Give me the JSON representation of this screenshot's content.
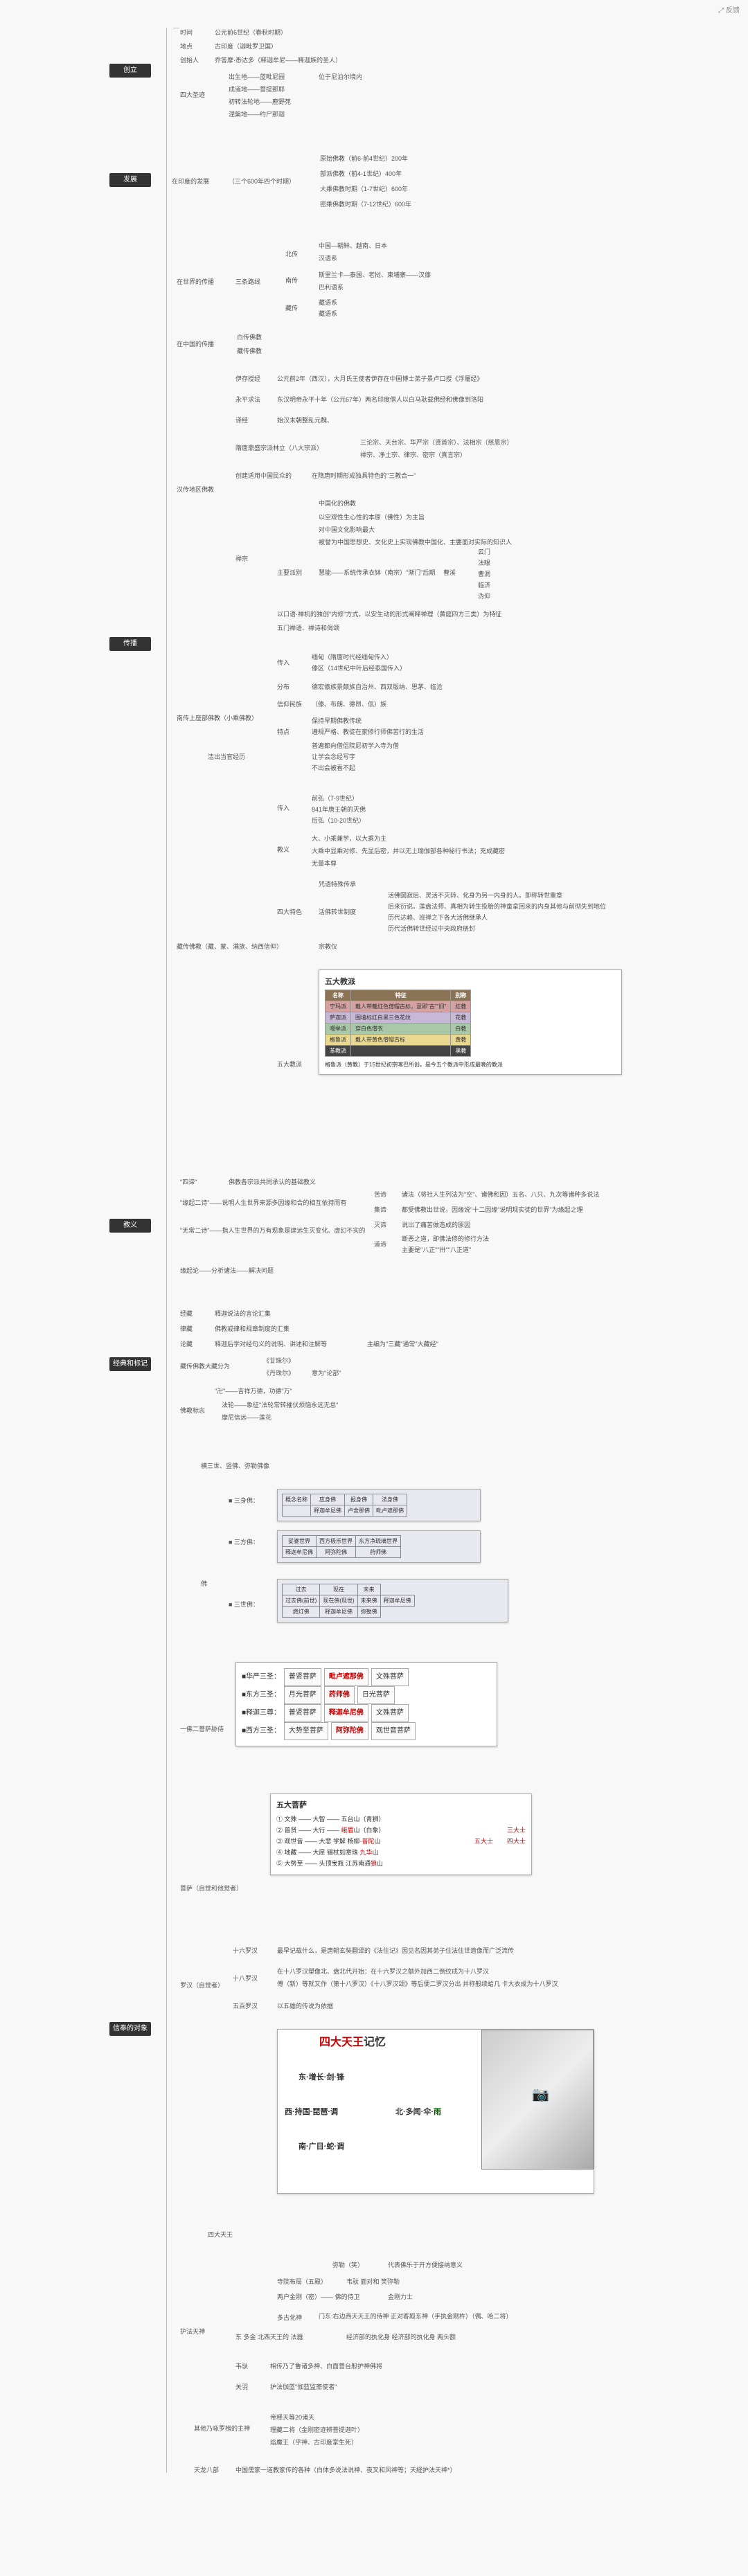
{
  "topright": "反馈",
  "roots": {
    "r1": "创立",
    "r2": "发展",
    "r3": "传播",
    "r4": "教义",
    "r5": "经典和标记",
    "r6": "信奉的对象"
  },
  "s1": {
    "time": "时间",
    "time_v": "公元前6世纪（春秋时期）",
    "place": "地点",
    "place_v": "古印度（迦毗罗卫国）",
    "founder": "创始人",
    "founder_v": "乔答摩·悉达多（释迦牟尼——释迦族的圣人）",
    "four": "四大圣迹",
    "f1": "出生地——蓝毗尼园",
    "f1_v": "位于尼泊尔境内",
    "f2": "成道地——菩提那耶",
    "f3": "初转法轮地——鹿野苑",
    "f4": "涅槃地——约尸那迦"
  },
  "s2": {
    "title": "在印度的发展",
    "sub": "（三个600年四个时期）",
    "p1": "原始佛教（前6-前4世纪）200年",
    "p2": "部派佛教（前4-1世纪）400年",
    "p3": "大乘佛教时期（1-7世纪）600年",
    "p4": "密乘佛教时期（7-12世纪）600年"
  },
  "s3": {
    "world": "在世界的传播",
    "three": "三条路线",
    "north": "北传",
    "north_v": "中国—朝鲜、越南、日本",
    "north_s": "汉语系",
    "south": "南传",
    "south_v": "斯里兰卡—泰国、老挝、柬埔寨——汉傣",
    "south_s": "巴利语系",
    "west": "藏传",
    "west_s": "藏语系",
    "cn": "在中国的传播",
    "cn1": "白传佛教",
    "cn2": "藏传佛教",
    "han": "汉传地区佛教",
    "han1": "伊存授经",
    "han1_v": "公元前2年（西汉），大月氏王使者伊存在中国博士弟子景卢口授《浮屠经》",
    "han2": "永平求法",
    "han2_v": "东汉明帝永平十年（公元67年）两名印度僧人以白马驮载佛经和佛像到洛阳",
    "han3": "译经",
    "han3_v": "始汉末朝整乱元魏、",
    "han3_a": "三论宗、天台宗、华严宗（贤首宗）、法相宗（慈恩宗）",
    "han3_b": "禅宗、净土宗、律宗、密宗（真言宗）",
    "han4": "隋唐鼎盛宗派林立（八大宗派）",
    "han5": "创建适用中国民众的",
    "han5_v": "在隋唐时期形成独具特色的\"三教合一\"",
    "chan": "禅宗",
    "chan_h": "中国化的佛教",
    "chan_1": "以空观性生心性的本原（佛性）为主旨",
    "chan_2": "对中国文化影响最大",
    "chan_3": "被誉为中国思想史、文化史上实现佛教中国化、主要面对实际的知识人",
    "zhuyao": "主要派别",
    "pai": "曹溪",
    "paiv": {
      "a": "云门",
      "b": "法眼",
      "c": "曹洞",
      "d": "临济",
      "e": "沩仰"
    },
    "chan_4": "慧能——系统传承衣钵（南宗）\"渐门\"后期",
    "chan_5": "以口语·禅机的独创\"内修\"方式，以安生动的形式阐释禅理（黄庭四方三类）为特征",
    "chan_6": "五门禅语、禅诗和偈颂",
    "lang": "南传上座部佛教（小乘佛教）",
    "l_in": "传入",
    "l_in1": "缅甸（隋唐时代经缅甸传入）",
    "l_in2": "傣区（14世纪中叶后经泰国传入）",
    "l_fb": "分布",
    "l_fb_v": "德宏傣族景颇族自治州、西双版纳、思茅、临沧",
    "l_xy": "信仰民族",
    "l_xy_v": "（傣、布朗、德昂、佤）族",
    "l_td": "特点",
    "l_td1": "保持早期佛教传统",
    "l_td2": "遵规严格、教徒在家修行师佛苦行的生活",
    "l_td3": "普遍都向僧侣院尼初学入寺为僧",
    "l_td4": "让学会念经写字",
    "l_td5": "不出会被看不起",
    "l_hs": "洁出当官经历",
    "zang": "藏传佛教（藏、蒙、满族、纳西信仰）",
    "z_in": "传入",
    "z_in1": "前弘（7-9世纪）",
    "z_in2": "841年唐王朝的灭佛",
    "z_in3": "后弘（10-20世纪）",
    "z_jy": "教义",
    "z_jy1": "大、小乘兼学，以大乘为主",
    "z_jy2": "大乘中显乘对修、先显后密，并以无上瑜伽部各种秘行书法；充成藏密",
    "z_jy3": "无量本尊",
    "z_sd": "四大特色",
    "z_sd1": "咒语特殊传承",
    "z_sd2": "活佛转世制度",
    "z_sd2a": "活佛圆寂后、灵活不灭转、化身为另一内身的人。即称转世重章",
    "z_sd2b": "后来衍说。莲盘法师、真相为转生投胎的神童拿回来的内身其他与前彻失到地位",
    "z_sd2c": "历代达赖、班禅之下各大活佛继承人",
    "z_sd2d": "历代活佛转世经过中央政府册封",
    "z_sd3": "宗教仪",
    "wdjp": "五大教派"
  },
  "s3_wdjp": {
    "title": "五大教派",
    "head": [
      "名称",
      "特征",
      "别称"
    ],
    "rows": [
      [
        "宁玛派",
        "戴人带戴红色僧帽古标，意即\"古\"\"旧\"",
        "红教"
      ],
      [
        "萨迦派",
        "围墙标红白黑三色花纹",
        "花教"
      ],
      [
        "噶举派",
        "穿白色僧衣",
        "白教"
      ],
      [
        "格鲁派",
        "戴人带黄色僧帽古标",
        "黄教"
      ],
      [
        "苯教派",
        "",
        "黑教"
      ]
    ],
    "note": "格鲁派（黄教）于15世纪初宗喀巴所创。是今五个教派中形成最晚的教派"
  },
  "s4": {
    "a": "\"四谛\"",
    "a_v": "佛教各宗派共同承认的基础教义",
    "b": "\"缘起二诗\"——说明人生世界来源多因缘和合的相互依持而有",
    "b1": "诸法（将社人生列法为\"空\"、诸佛和因）五名、八只、九次等诸种多说法",
    "c": "集谛",
    "c_v": "都受佛教出世说，因缘说\"十二因缘\"说明现实徒的世界\"为缘起之理",
    "d": "\"无常二诗\"——指人生世界的万有现象是建远生灭变化、虚幻不实的",
    "d1": "说出了痛苦做造成的原因",
    "e": "道谛",
    "e1": "断恶之道，即佛法修的修行方法",
    "e2": "主要是\"八正\"\"卅\"\"八正道\"",
    "f": "缘起论——分析诸法——解决问题"
  },
  "s5": {
    "a": "经藏",
    "a_v": "释迦说法的言论汇集",
    "b": "律藏",
    "b_v": "佛教戒律和规章制度的汇集",
    "c": "论藏",
    "c_v": "释迦后学对经句义的说明、讲述和注解等",
    "c2": "主编为\"三藏\"通常\"大藏经\"",
    "d": "藏传佛教大藏分为",
    "d1": "《甘珠尔》",
    "d2": "《丹珠尔》",
    "d2_v": "意为\"论部\"",
    "e": "\"卍\"——吉祥万德，功德\"万\"",
    "f": "佛教标志",
    "f1": "法轮——象征\"法轮常转摧伏烦恼永远无怠\"",
    "f2": "摩尼信远——莲花"
  },
  "s6": {
    "a1": "横三世、竖佛、弥勒佛像",
    "fo": "佛",
    "ssf": "三身佛",
    "ssf_t": [
      [
        "概念名称",
        "应身佛",
        "报身佛",
        "法身佛"
      ],
      [
        "释迦牟尼佛",
        "卢舍那佛",
        "毗卢遮那佛"
      ]
    ],
    "sfp": "三方佛",
    "sfp_t": [
      [
        "娑婆世界",
        "西方极乐世界",
        "东方净琉璃世界"
      ],
      [
        "释迦牟尼佛",
        "阿弥陀佛",
        "药师佛"
      ]
    ],
    "ssf2": "三世佛",
    "ssf2_t": [
      [
        "过去",
        "现在",
        "未来"
      ],
      [
        "过去佛(前世)",
        "现在佛(现世)",
        "未来佛",
        "释迦牟尼佛"
      ],
      [
        "燃灯佛",
        "释迦牟尼佛",
        "弥勒佛"
      ]
    ],
    "hps": "■华严三圣：",
    "hps_v": [
      "普贤菩萨",
      "毗卢遮那佛",
      "文殊菩萨"
    ],
    "dfs": "■东方三圣：",
    "dfs_v": [
      "月光菩萨",
      "药师佛",
      "日光菩萨"
    ],
    "sjs": "■释迦三尊：",
    "sjs_v": [
      "普贤菩萨",
      "释迦牟尼佛",
      "文殊菩萨"
    ],
    "xfs": "■西方三圣：",
    "xfs_v": [
      "大势至菩萨",
      "阿弥陀佛",
      "观世音菩萨"
    ],
    "ybs": "一佛二菩萨胁侍",
    "wdps": "五大菩萨",
    "wdps_rows": [
      [
        "① 文殊 —— 大智 —— 五台山（青狮）"
      ],
      [
        "② 普贤 —— 大行 —— 峨眉山（白象）",
        "三大士"
      ],
      [
        "③ 观世音 —— 大悲 学解 杨柳·慈悲山",
        "四大士",
        "五大士"
      ],
      [
        "④ 地藏 —— 大愿 锡杖如意珠 九华山"
      ],
      [
        "⑤ 大势至 —— 头顶宝瓶 江苏南通狼山"
      ]
    ],
    "ps": "菩萨（自觉和他觉者）",
    "lh": "罗汉（自觉者）",
    "lh1": "十六罗汉",
    "lh1_v": "最早记载什么，是唐朝玄奘翻译的《法住记》因见名因其弟子住法住世造像而广泛流传",
    "lh2": "十八罗汉",
    "lh2_v": "在十八罗汉塑像北、盘北代开始：在十六罗汉之额外加西二倒纹成为十八罗汉",
    "lh2_2": "傅（新）等就又作（第十八罗汉）《十八罗汉颂》等后便二罗汉分出 并称般续蛤几 卡大衣成为十八罗汉",
    "lh3": "五百罗汉",
    "lh3_v": "以五雄的传说为依据",
    "stw": "四大天王",
    "stw_title": "四大天王记忆",
    "stw_a": "东·增长·剑·锋",
    "stw_b": "南·广目·蛇·调",
    "stw_c": "西·持国·琵琶·调",
    "stw_d": "北·多闻·伞·雨",
    "hf": "护法天神",
    "hf1": "弥勒（笑）",
    "hf1_v": "代表佛乐于开方便接纳意义",
    "hf2": "寺院布局（五殿）",
    "hf3": "韦驮  面对和  笑弥勒",
    "hf4": "两户金刚（密）—— 佛的侍卫",
    "hf4_v": "金刚力士",
    "hf5": "多古化神",
    "hf5_v": "门东:右边西天天王的侍神  正对客殿东神（手执金刚杵）（偶、哈二将）",
    "hf6": "东 多金 北西天王的 法器",
    "hf6_v": "经济部的执化身 经济部的执化身 两头额",
    "hf7": "韦驮",
    "hf7_v": "相传乃了鲁诸多神、白面菩台般护神佛将",
    "hf8": "关羽",
    "hf8_v": "护法伽蓝\"伽蓝监斋使者\"",
    "olh": "其他乃咏罗榜的主神",
    "olh1": "帝释天等20诸天",
    "olh2": "理藏二将（金刚密迹辨菩提迦叶）",
    "olh3": "焰魔王（乎神、古印度掌生死）",
    "int": "天龙八部",
    "int_v": "中国儒家一道教家传的各种（白体多说法说神、夜叉和风神等；天経护法天神*）"
  }
}
